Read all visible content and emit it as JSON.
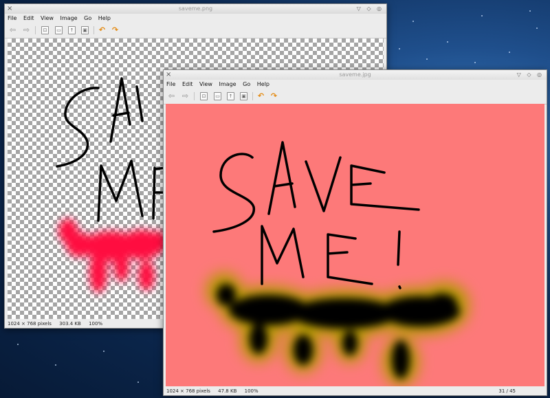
{
  "desktop": {
    "background": "#0d2c57"
  },
  "windows": [
    {
      "title": "saveme.png",
      "close_icon": "×",
      "window_buttons": "▽ ◇ ◎",
      "menu": [
        "File",
        "Edit",
        "View",
        "Image",
        "Go",
        "Help"
      ],
      "toolbar_icons": [
        "back-arrow-icon",
        "forward-arrow-icon",
        "open-icon",
        "print-icon",
        "export-icon",
        "save-icon",
        "rotate-left-icon",
        "rotate-right-icon"
      ],
      "image": {
        "background": "checkerboard-transparency",
        "ink_color": "#000000",
        "blob_color": "#ff1040",
        "text_drawn": "SAVE ME!"
      },
      "status": {
        "dimensions": "1024 × 768 pixels",
        "size": "303.4 KB",
        "zoom": "100%"
      }
    },
    {
      "title": "saveme.jpg",
      "close_icon": "×",
      "window_buttons": "▽ ◇ ◎",
      "menu": [
        "File",
        "Edit",
        "View",
        "Image",
        "Go",
        "Help"
      ],
      "toolbar_icons": [
        "back-arrow-icon",
        "forward-arrow-icon",
        "open-icon",
        "print-icon",
        "export-icon",
        "save-icon",
        "rotate-left-icon",
        "rotate-right-icon"
      ],
      "image": {
        "background": "#fd7979",
        "ink_color": "#000000",
        "glow_color": "#b39a00",
        "text_drawn": "SAVE ME!"
      },
      "status": {
        "dimensions": "1024 × 768 pixels",
        "size": "47.8 KB",
        "zoom": "100%",
        "position": "31 / 45"
      }
    }
  ]
}
